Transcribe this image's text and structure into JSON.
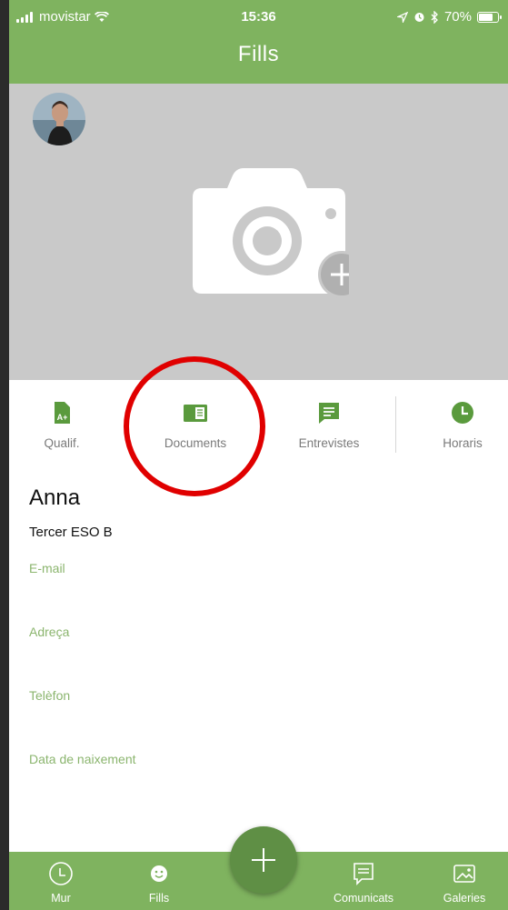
{
  "status": {
    "carrier": "movistar",
    "time": "15:36",
    "battery": "70%"
  },
  "header": {
    "title": "Fills"
  },
  "tabs": [
    {
      "label": "Qualif.",
      "icon": "grade-document-icon"
    },
    {
      "label": "Documents",
      "icon": "documents-icon"
    },
    {
      "label": "Entrevistes",
      "icon": "chat-bubble-icon"
    },
    {
      "label": "Horaris",
      "icon": "clock-icon"
    }
  ],
  "profile": {
    "name": "Anna",
    "class": "Tercer ESO B",
    "fields": [
      "E-mail",
      "Adreça",
      "Telèfon",
      "Data de naixement"
    ]
  },
  "bottom_nav": [
    {
      "label": "Mur",
      "icon": "clock-icon"
    },
    {
      "label": "Fills",
      "icon": "smiley-icon"
    },
    {
      "label": "Comunicats",
      "icon": "message-icon"
    },
    {
      "label": "Galeries",
      "icon": "gallery-icon"
    }
  ],
  "colors": {
    "brand_green": "#7fb35f",
    "fab_green": "#5f8f45",
    "field_label": "#8bb56e",
    "highlight": "#e00000"
  }
}
